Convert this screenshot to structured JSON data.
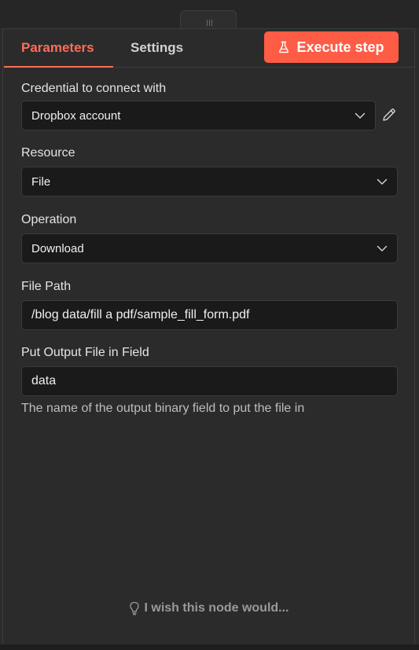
{
  "tabs": [
    {
      "label": "Parameters"
    },
    {
      "label": "Settings"
    }
  ],
  "execute_button": {
    "label": "Execute step",
    "icon": "flask-icon"
  },
  "credential": {
    "label": "Credential to connect with",
    "value": "Dropbox account",
    "edit_icon": "pencil-icon"
  },
  "resource": {
    "label": "Resource",
    "value": "File"
  },
  "operation": {
    "label": "Operation",
    "value": "Download"
  },
  "file_path": {
    "label": "File Path",
    "value": "/blog data/fill a pdf/sample_fill_form.pdf"
  },
  "output_field": {
    "label": "Put Output File in Field",
    "value": "data",
    "hint": "The name of the output binary field to put the file in"
  },
  "feedback": {
    "label": "I wish this node would...",
    "icon": "lightbulb-icon"
  },
  "colors": {
    "accent": "#ff6d5a",
    "execute_button_bg": "#ff5c45",
    "panel_bg": "#2b2b2b",
    "input_bg": "#1a1a1a"
  }
}
